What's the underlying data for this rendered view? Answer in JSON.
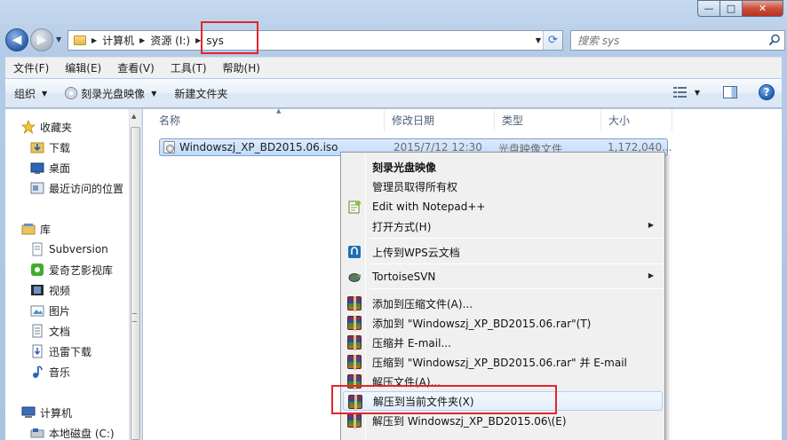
{
  "search": {
    "placeholder": "搜索 sys"
  },
  "breadcrumb": [
    "计算机",
    "资源 (I:)",
    "sys"
  ],
  "menubar": [
    "文件(F)",
    "编辑(E)",
    "查看(V)",
    "工具(T)",
    "帮助(H)"
  ],
  "commands": {
    "organize": "组织",
    "burn": "刻录光盘映像",
    "new_folder": "新建文件夹"
  },
  "nav": {
    "favorites": "收藏夹",
    "favorites_items": [
      "下载",
      "桌面",
      "最近访问的位置"
    ],
    "libraries": "库",
    "library_items": [
      "Subversion",
      "爱奇艺影视库",
      "视频",
      "图片",
      "文档",
      "迅雷下载",
      "音乐"
    ],
    "computer": "计算机",
    "computer_items": [
      "本地磁盘 (C:)"
    ]
  },
  "columns": {
    "name": "名称",
    "date": "修改日期",
    "type": "类型",
    "size": "大小"
  },
  "file": {
    "name": "Windowszj_XP_BD2015.06.iso",
    "date": "2015/7/12 12:30",
    "type": "光盘映像文件",
    "size": "1,172,040..."
  },
  "context_menu": [
    "刻录光盘映像",
    "管理员取得所有权",
    "Edit with Notepad++",
    "打开方式(H)",
    "上传到WPS云文档",
    "TortoiseSVN",
    "添加到压缩文件(A)...",
    "添加到 \"Windowszj_XP_BD2015.06.rar\"(T)",
    "压缩并 E-mail...",
    "压缩到 \"Windowszj_XP_BD2015.06.rar\" 并 E-mail",
    "解压文件(A)...",
    "解压到当前文件夹(X)",
    "解压到 Windowszj_XP_BD2015.06\\(E)"
  ],
  "colors": {
    "highlight_box": "#e2262b",
    "selection": "#c1dbfc",
    "accent": "#1f5fb5"
  }
}
